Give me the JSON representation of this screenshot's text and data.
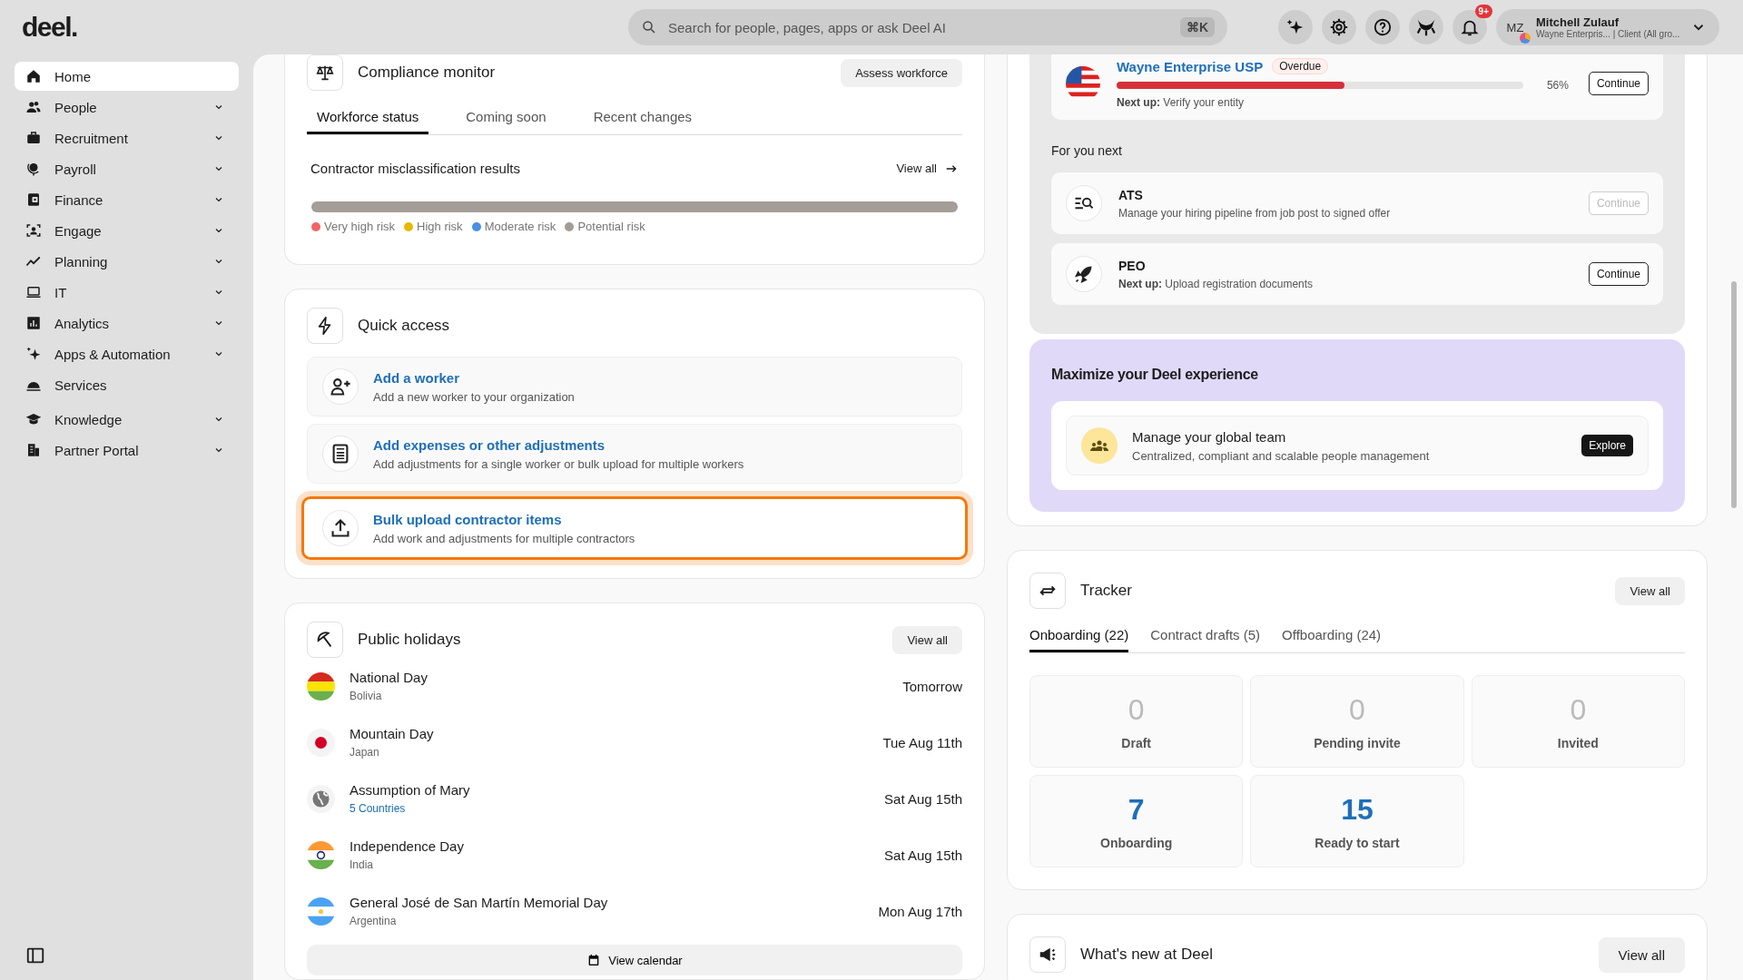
{
  "header": {
    "logo": "deel.",
    "search": {
      "placeholder": "Search for people, pages, apps or ask Deel AI",
      "shortcut": "⌘K"
    },
    "actions": [
      {
        "kind": "ai"
      },
      {
        "kind": "settings"
      },
      {
        "kind": "help"
      },
      {
        "kind": "eye"
      },
      {
        "kind": "bell",
        "badge": "9+"
      }
    ],
    "user": {
      "initials": "MZ",
      "name": "Mitchell Zulauf",
      "org": "Wayne Enterpris... | Client (All gro..."
    }
  },
  "sidebar": {
    "items": [
      {
        "label": "Home",
        "selected": true,
        "expandable": false
      },
      {
        "label": "People",
        "selected": false,
        "expandable": true
      },
      {
        "label": "Recruitment",
        "selected": false,
        "expandable": true
      },
      {
        "label": "Payroll",
        "selected": false,
        "expandable": true
      },
      {
        "label": "Finance",
        "selected": false,
        "expandable": true
      },
      {
        "label": "Engage",
        "selected": false,
        "expandable": true
      },
      {
        "label": "Planning",
        "selected": false,
        "expandable": true
      },
      {
        "label": "IT",
        "selected": false,
        "expandable": true
      },
      {
        "label": "Analytics",
        "selected": false,
        "expandable": true
      },
      {
        "label": "Apps & Automation",
        "selected": false,
        "expandable": true
      },
      {
        "label": "Services",
        "selected": false,
        "expandable": false
      },
      {
        "label": "Knowledge",
        "selected": false,
        "expandable": true
      },
      {
        "label": "Partner Portal",
        "selected": false,
        "expandable": true
      }
    ]
  },
  "compliance": {
    "title": "Compliance monitor",
    "action": "Assess workforce",
    "tabs": [
      {
        "label": "Workforce status",
        "selected": true
      },
      {
        "label": "Coming soon",
        "selected": false
      },
      {
        "label": "Recent changes",
        "selected": false
      }
    ],
    "results_title": "Contractor misclassification results",
    "view_all": "View all",
    "legend": [
      {
        "label": "Very high risk",
        "color": "#f26464"
      },
      {
        "label": "High risk",
        "color": "#e6b800"
      },
      {
        "label": "Moderate risk",
        "color": "#4a90e2"
      },
      {
        "label": "Potential risk",
        "color": "#a39b95"
      }
    ]
  },
  "quick_access": {
    "title": "Quick access",
    "items": [
      {
        "title": "Add a worker",
        "description": "Add a new worker to your organization",
        "highlighted": false
      },
      {
        "title": "Add expenses or other adjustments",
        "description": "Add adjustments for a single worker or bulk upload for multiple workers",
        "highlighted": false
      },
      {
        "title": "Bulk upload contractor items",
        "description": "Add work and adjustments for multiple contractors",
        "highlighted": true
      }
    ]
  },
  "holidays": {
    "title": "Public holidays",
    "view_all": "View all",
    "items": [
      {
        "kind": "bolivia",
        "name": "National Day",
        "place": "Bolivia",
        "place_link": false,
        "date": "Tomorrow"
      },
      {
        "kind": "japan",
        "name": "Mountain Day",
        "place": "Japan",
        "place_link": false,
        "date": "Tue Aug 11th"
      },
      {
        "kind": "globe",
        "name": "Assumption of Mary",
        "place": "5 Countries",
        "place_link": true,
        "date": "Sat Aug 15th"
      },
      {
        "kind": "india",
        "name": "Independence Day",
        "place": "India",
        "place_link": false,
        "date": "Sat Aug 15th"
      },
      {
        "kind": "argentina",
        "name": "General José de San Martín Memorial Day",
        "place": "Argentina",
        "place_link": false,
        "date": "Mon Aug 17th"
      }
    ],
    "calendar_button": "View calendar"
  },
  "onboarding": {
    "entity": {
      "name": "Wayne Enterprise USP",
      "badge": "Overdue",
      "level": 0.56,
      "percent": "56%",
      "next": "**Next up:** Verify your entity",
      "button": "Continue"
    },
    "next_title": "For you next",
    "next_items": [
      {
        "title": "ATS",
        "description": "Manage your hiring pipeline from job post to signed offer",
        "button": "Continue",
        "disabled": true
      },
      {
        "title": "PEO",
        "description": "**Next up:** Upload registration documents",
        "button": "Continue",
        "disabled": false
      }
    ]
  },
  "promo": {
    "title": "Maximize your Deel experience",
    "card_title": "Manage your global team",
    "card_text": "Centralized, compliant and scalable people management",
    "button": "Explore"
  },
  "tracker": {
    "title": "Tracker",
    "view_all": "View all",
    "tabs": [
      {
        "label": "Onboarding (22)",
        "selected": true
      },
      {
        "label": "Contract drafts (5)",
        "selected": false
      },
      {
        "label": "Offboarding (24)",
        "selected": false
      }
    ],
    "stats": [
      {
        "value": "0",
        "label": "Draft",
        "active": false
      },
      {
        "value": "0",
        "label": "Pending invite",
        "active": false
      },
      {
        "value": "0",
        "label": "Invited",
        "active": false
      },
      {
        "value": "7",
        "label": "Onboarding",
        "active": true
      },
      {
        "value": "15",
        "label": "Ready to start",
        "active": true
      }
    ]
  },
  "whats_new": {
    "title": "What's new at Deel",
    "view_all": "View all"
  }
}
